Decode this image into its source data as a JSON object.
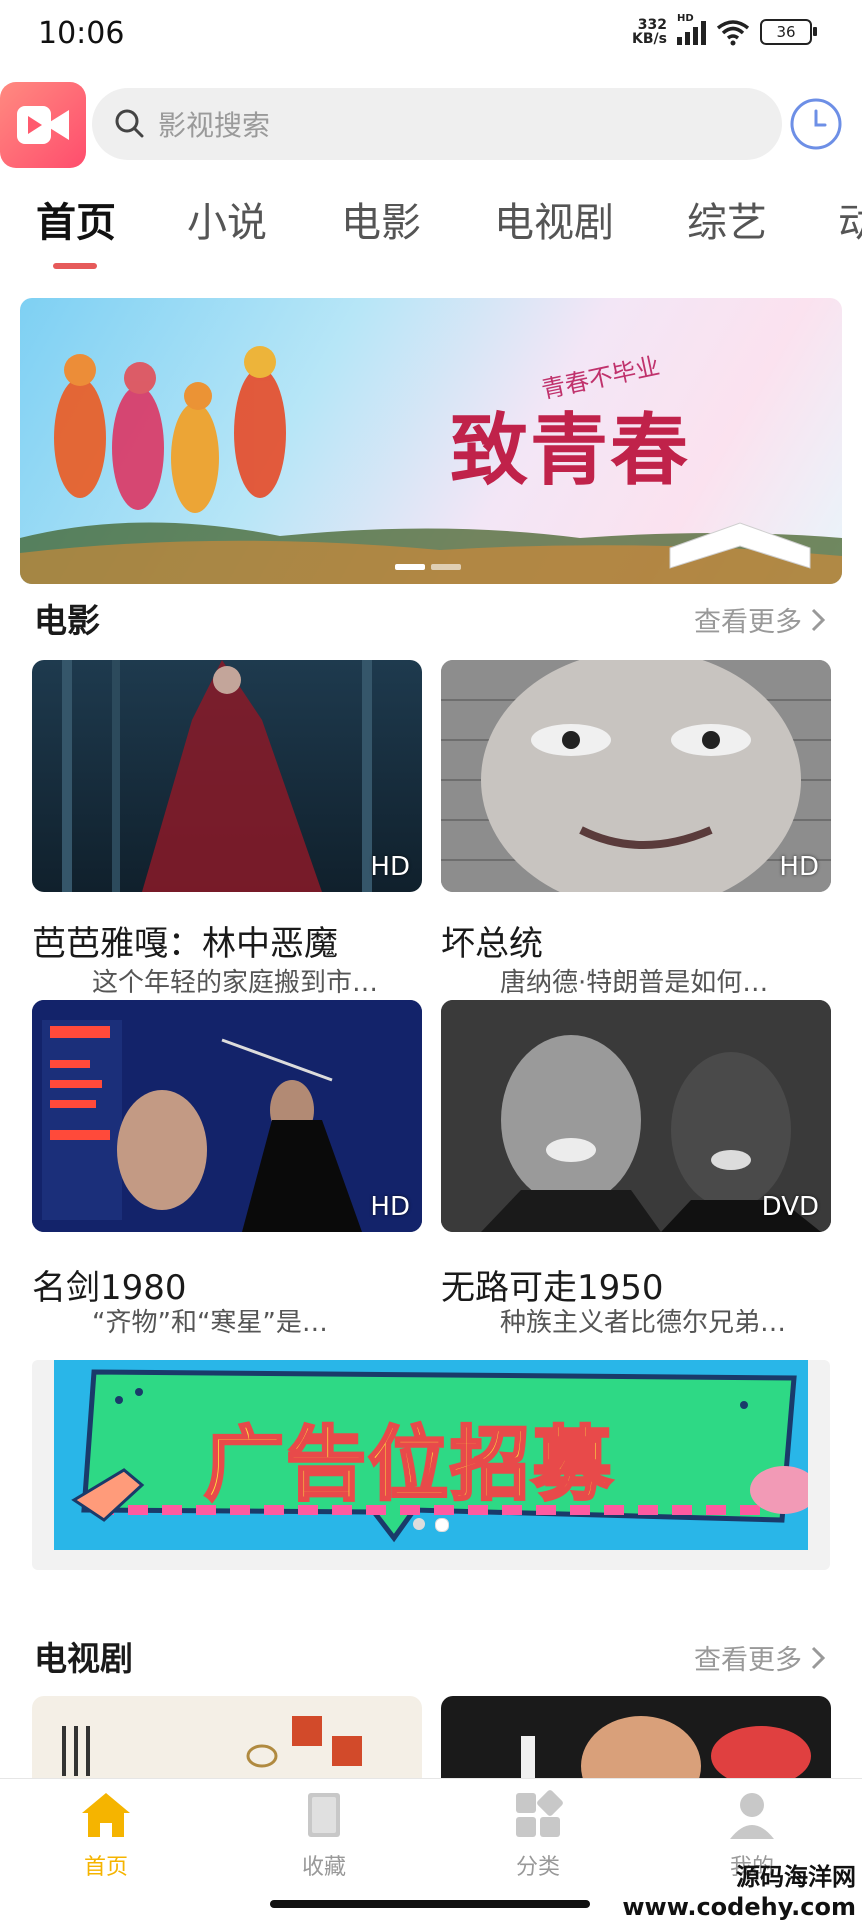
{
  "status_bar": {
    "time": "10:06",
    "net_speed": "332",
    "net_unit": "KB/s",
    "signal_tag": "HD",
    "battery": "36"
  },
  "header": {
    "search_placeholder": "影视搜索"
  },
  "tabs": [
    "首页",
    "小说",
    "电影",
    "电视剧",
    "综艺",
    "动"
  ],
  "banner": {
    "title": "致青春",
    "subtitle": "青春不毕业"
  },
  "movies": {
    "title": "电影",
    "more": "查看更多",
    "items": [
      {
        "title": "芭芭雅嘎：林中恶魔",
        "desc": "这个年轻的家庭搬到市…",
        "badge": "HD"
      },
      {
        "title": "坏总统",
        "desc": "唐纳德·特朗普是如何…",
        "badge": "HD"
      },
      {
        "title": "名剑1980",
        "desc": "“齐物”和“寒星”是…",
        "badge": "HD"
      },
      {
        "title": "无路可走1950",
        "desc": "种族主义者比德尔兄弟…",
        "badge": "DVD"
      }
    ]
  },
  "ad": {
    "text": "广告位招募"
  },
  "tv": {
    "title": "电视剧",
    "more": "查看更多"
  },
  "bottom_nav": [
    {
      "label": "首页"
    },
    {
      "label": "收藏"
    },
    {
      "label": "分类"
    },
    {
      "label": "我的"
    }
  ],
  "watermark": {
    "line1": "源码海洋网",
    "line2": "www.codehy.com"
  },
  "colors": {
    "accent": "#f5b400",
    "tab_indicator": "#e65a5a"
  }
}
